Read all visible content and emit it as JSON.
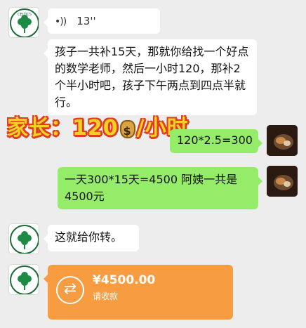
{
  "chat": {
    "messages": [
      {
        "sender": "other",
        "type": "voice",
        "duration": "13''"
      },
      {
        "sender": "other",
        "type": "text",
        "text": "孩子一共补15天，那就你给找一个好点的数学老师，然后一小时120，那补2个半小时吧，孩子下午两点到四点半就行。"
      },
      {
        "sender": "self",
        "type": "text",
        "text": "120*2.5=300"
      },
      {
        "sender": "self",
        "type": "text",
        "text": "一天300*15天=4500 阿姨一共是4500元"
      },
      {
        "sender": "other",
        "type": "text",
        "text": "这就给你转。"
      },
      {
        "sender": "other",
        "type": "transfer",
        "amount": "¥4500.00",
        "note": "请收款"
      }
    ]
  },
  "overlay": {
    "prefix": "家长：120",
    "suffix": "/小时",
    "icon": "money-bag-icon"
  },
  "avatars": {
    "other_icon": "clover-icon",
    "other_text": "CELTICS",
    "self_icon": "photo-avatar"
  },
  "colors": {
    "background": "#ededed",
    "self_bubble": "#95ec69",
    "other_bubble": "#ffffff",
    "transfer": "#f79c41",
    "overlay_fill": "#f2d024",
    "overlay_outline": "#e23b1e"
  }
}
